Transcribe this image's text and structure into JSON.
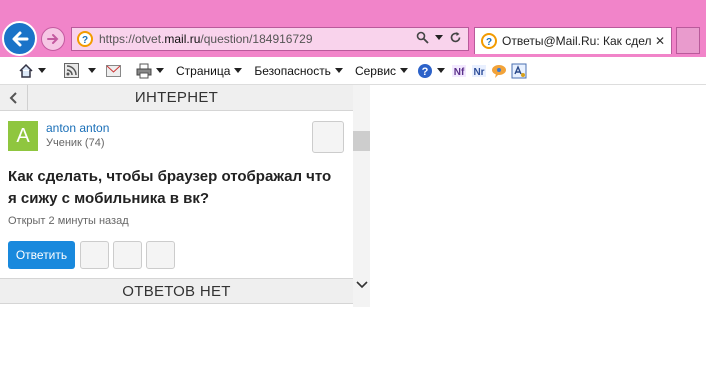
{
  "browser": {
    "url_prefix": "https://otvet.",
    "url_domain": "mail.ru",
    "url_path": "/question/184916729",
    "tab_title": "Ответы@Mail.Ru: Как сдел...",
    "tab_close": "✕",
    "chrome_color": "#f184c9"
  },
  "commandbar": {
    "menus": [
      "Страница",
      "Безопасность",
      "Сервис"
    ]
  },
  "page": {
    "category": "ИНТЕРНЕТ",
    "user": {
      "avatar_letter": "A",
      "name": "anton anton",
      "rank": "Ученик (74)"
    },
    "question": {
      "title": "Как сделать, чтобы браузер отображал что я сижу с мобильника в вк?",
      "meta": "Открыт 2 минуты назад"
    },
    "reply_label": "Ответить",
    "answers_header": "ОТВЕТОВ НЕТ",
    "accent_color": "#1989dd"
  }
}
